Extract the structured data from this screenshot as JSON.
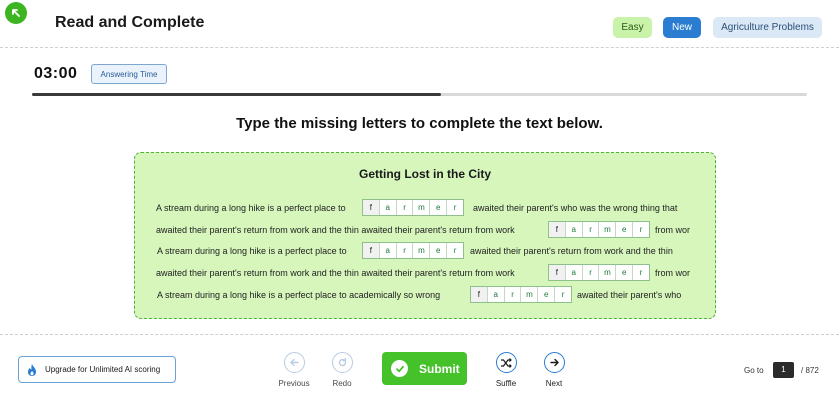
{
  "header": {
    "title": "Read and Complete",
    "tags": {
      "difficulty": "Easy",
      "status": "New",
      "topic": "Agriculture Problems"
    }
  },
  "timer": {
    "value": "03:00",
    "label": "Answering Time",
    "progress_percent": 52.8
  },
  "instruction": "Type the missing letters to complete the text below.",
  "passage": {
    "title": "Getting Lost in the City",
    "blank_letters": [
      "f",
      "a",
      "r",
      "m",
      "e",
      "r"
    ],
    "lines": [
      [
        "A stream during a long hike is a perfect place to",
        "awaited their parent's who was the wrong thing that"
      ],
      [
        "awaited their parent's return from work  and the thin  awaited their parent's return from work",
        "from wor"
      ],
      [
        "A stream during a long hike is a perfect place to",
        "awaited their parent's return from work  and the thin"
      ],
      [
        "awaited their parent's return from work  and the thin  awaited their parent's return from work",
        "from wor"
      ],
      [
        "A stream during a long hike is a perfect place to academically so wrong",
        "awaited their parent's who"
      ]
    ]
  },
  "footer": {
    "upgrade_label": "Upgrade for Unlimited  AI scoring",
    "previous_label": "Previous",
    "redo_label": "Redo",
    "submit_label": "Submit",
    "shuffle_label": "Suffle",
    "next_label": "Next",
    "goto_label": "Go to",
    "goto_value": "1",
    "total_label": "/ 872"
  },
  "colors": {
    "accent_green": "#45c12a",
    "accent_blue": "#2a7dd1",
    "passage_bg": "#d6f6bc"
  }
}
